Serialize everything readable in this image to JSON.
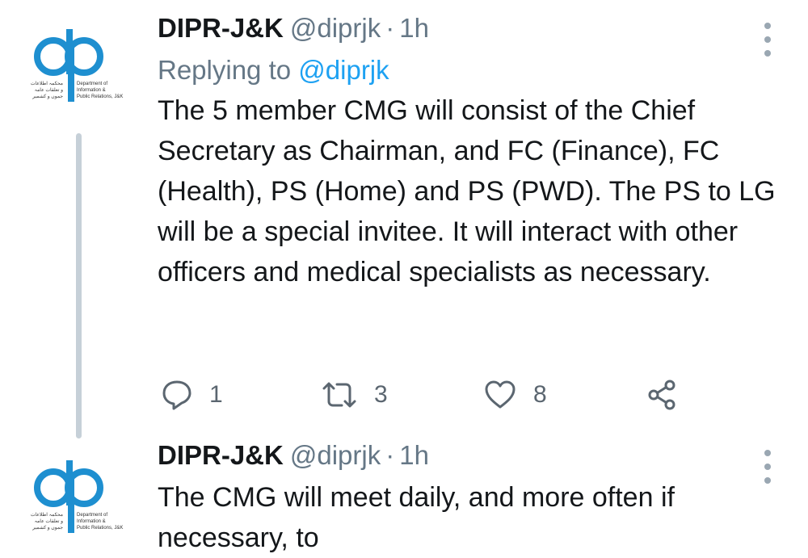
{
  "theme": {
    "text": "#14171a",
    "muted": "#657786",
    "link": "#1da1f2",
    "thread_line": "#c6d0d8"
  },
  "avatar": {
    "icon": "dipr-logo-icon",
    "logo_text_lines": [
      "Department of",
      "Information &",
      "Public Relations, J&K"
    ],
    "logo_urdu_lines": [
      "محکمہ اطلاعات",
      "و تعلقات عامہ",
      "جموں و کشمیر"
    ]
  },
  "tweets": [
    {
      "name": "DIPR-J&K",
      "handle": "@diprjk",
      "separator": "·",
      "time": "1h",
      "replying_prefix": "Replying to",
      "replying_handle": "@diprjk",
      "text": "The 5 member CMG will consist of the Chief Secretary as Chairman, and FC (Finance), FC (Health), PS (Home) and PS (PWD). The PS to LG will be a special invitee. It will interact with other officers and medical specialists as necessary.",
      "actions": {
        "replies": "1",
        "retweets": "3",
        "likes": "8"
      }
    },
    {
      "name": "DIPR-J&K",
      "handle": "@diprjk",
      "separator": "·",
      "time": "1h",
      "text": "The CMG will meet daily, and more often if necessary, to"
    }
  ]
}
